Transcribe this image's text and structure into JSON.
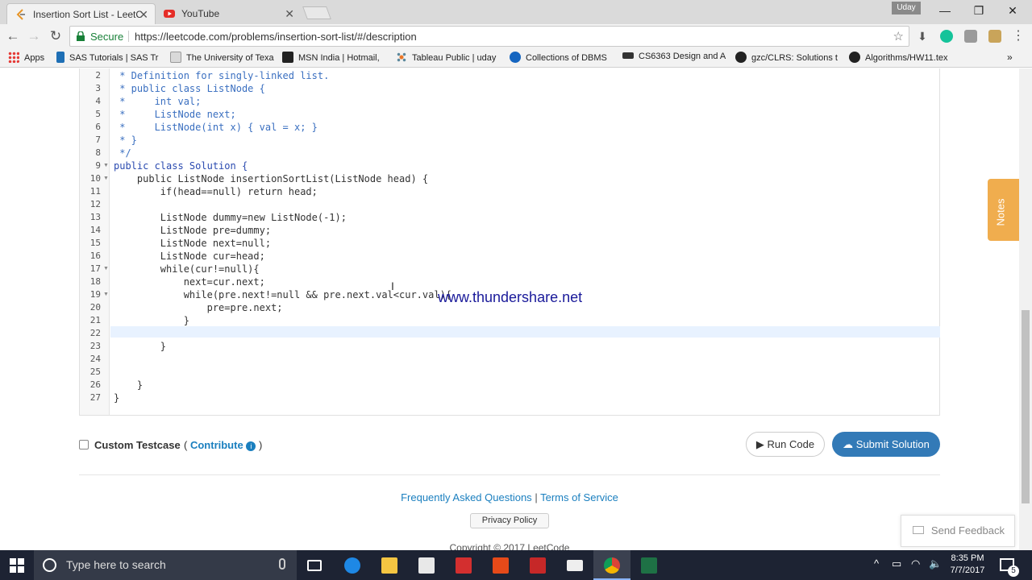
{
  "browser": {
    "tabs": [
      {
        "title": "Insertion Sort List - LeetC",
        "active": true
      },
      {
        "title": "YouTube",
        "active": false
      }
    ],
    "profile_name": "Uday",
    "omnibox": {
      "security_label": "Secure",
      "url": "https://leetcode.com/problems/insertion-sort-list/#/description"
    },
    "bookmarks": [
      {
        "label": "Apps",
        "icon": "apps-grid-icon"
      },
      {
        "label": "SAS Tutorials | SAS Tr",
        "icon": "sas-icon"
      },
      {
        "label": "The University of Texa",
        "icon": "utd-icon"
      },
      {
        "label": "MSN India | Hotmail,",
        "icon": "msn-icon"
      },
      {
        "label": "Tableau Public | uday",
        "icon": "tableau-icon"
      },
      {
        "label": "Collections of DBMS",
        "icon": "info-icon"
      },
      {
        "label": "CS6363 Design and A",
        "icon": "utd-icon"
      },
      {
        "label": "gzc/CLRS: Solutions t",
        "icon": "github-icon"
      },
      {
        "label": "Algorithms/HW11.tex",
        "icon": "github-icon"
      }
    ]
  },
  "editor": {
    "lines": [
      {
        "n": "2",
        "text": " * Definition for singly-linked list.",
        "cls": "cm"
      },
      {
        "n": "3",
        "text": " * public class ListNode {",
        "cls": "cm"
      },
      {
        "n": "4",
        "text": " *     int val;",
        "cls": "cm"
      },
      {
        "n": "5",
        "text": " *     ListNode next;",
        "cls": "cm"
      },
      {
        "n": "6",
        "text": " *     ListNode(int x) { val = x; }",
        "cls": "cm"
      },
      {
        "n": "7",
        "text": " * }",
        "cls": "cm"
      },
      {
        "n": "8",
        "text": " */",
        "cls": "cm"
      },
      {
        "n": "9",
        "text": "public class Solution {",
        "cls": "kw",
        "fold": true
      },
      {
        "n": "10",
        "text": "    public ListNode insertionSortList(ListNode head) {",
        "cls": "mix",
        "fold": true
      },
      {
        "n": "11",
        "text": "        if(head==null) return head;",
        "cls": "mix"
      },
      {
        "n": "12",
        "text": "",
        "cls": ""
      },
      {
        "n": "13",
        "text": "        ListNode dummy=new ListNode(-1);",
        "cls": "mix"
      },
      {
        "n": "14",
        "text": "        ListNode pre=dummy;",
        "cls": ""
      },
      {
        "n": "15",
        "text": "        ListNode next=null;",
        "cls": "mix"
      },
      {
        "n": "16",
        "text": "        ListNode cur=head;",
        "cls": ""
      },
      {
        "n": "17",
        "text": "        while(cur!=null){",
        "cls": "mix",
        "fold": true
      },
      {
        "n": "18",
        "text": "            next=cur.next;",
        "cls": ""
      },
      {
        "n": "19",
        "text": "            while(pre.next!=null && pre.next.val<cur.val){",
        "cls": "mix",
        "fold": true
      },
      {
        "n": "20",
        "text": "                pre=pre.next;",
        "cls": ""
      },
      {
        "n": "21",
        "text": "            }",
        "cls": ""
      },
      {
        "n": "22",
        "text": "",
        "cls": ""
      },
      {
        "n": "23",
        "text": "        }",
        "cls": ""
      },
      {
        "n": "24",
        "text": "",
        "cls": ""
      },
      {
        "n": "25",
        "text": "",
        "cls": ""
      },
      {
        "n": "26",
        "text": "    }",
        "cls": ""
      },
      {
        "n": "27",
        "text": "}",
        "cls": ""
      }
    ]
  },
  "watermark": "www.thundershare.net",
  "testcase": {
    "label": "Custom Testcase",
    "contribute_prefix": "(",
    "contribute_link": "Contribute",
    "contribute_suffix": ")"
  },
  "buttons": {
    "run_code": "Run Code",
    "submit": "Submit Solution"
  },
  "footer": {
    "faq": "Frequently Asked Questions",
    "separator": "|",
    "terms": "Terms of Service",
    "privacy": "Privacy Policy",
    "copyright": "Copyright © 2017 LeetCode"
  },
  "side": {
    "notes": "Notes",
    "feedback": "Send Feedback"
  },
  "taskbar": {
    "search_placeholder": "Type here to search",
    "time": "8:35 PM",
    "date": "7/7/2017",
    "notification_count": "5"
  },
  "colors": {
    "accent_blue": "#337ab7",
    "link_blue": "#1a7fbf",
    "notes_orange": "#f0ad4e",
    "secure_green": "#188038"
  }
}
